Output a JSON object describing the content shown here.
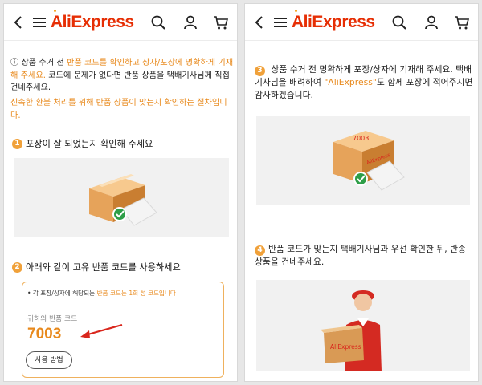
{
  "header": {
    "back_icon": "chevron-left-icon",
    "menu_icon": "hamburger-menu-icon",
    "logo_prefix": "Ali",
    "logo_suffix": "Express",
    "search_icon": "search-icon",
    "account_icon": "user-icon",
    "cart_icon": "cart-icon",
    "brand_color": "#e62e04"
  },
  "left": {
    "intro": {
      "info_icon": "ⓘ",
      "part1": "상품 수거 전 ",
      "part2_orange": "반품 코드를 확인하고 상자/포장에 명확하게 기재해 주세요.",
      "part3": " 코드에 문제가 없다면 반품 상품을 택배기사님께 직접 건네주세요.",
      "note_orange": "신속한 환불 처리를 위해 반품 상품이 맞는지 확인하는 절차입니다."
    },
    "step1": {
      "number": "1",
      "text": "포장이 잘 되었는지 확인해 주세요"
    },
    "step2": {
      "number": "2",
      "text": "아래와 같이 고유 반품 코드를 사용하세요"
    },
    "code_card": {
      "note_prefix": "• 각 포장/상자에 해당되는 ",
      "note_highlight": "반품 코드는 1회 성 코드입니다",
      "label": "귀하의 반품 코드",
      "code": "7003",
      "button": "사용 방법"
    }
  },
  "right": {
    "step3": {
      "number": "3",
      "part1": " 상품 수거 전 명확하게 포장/상자에 기재해 주세요. 택배기사님을 배려하여 ",
      "highlight": "\"AliExpress\"",
      "part2": "도 함께 포장에 적어주시면 감사하겠습니다."
    },
    "box_writing": "7003",
    "box_brand": "AliExpress",
    "step4": {
      "number": "4",
      "text": "반품 코드가 맞는지 택배기사님과 우선 확인한 뒤, 반송 상품을 건네주세요."
    },
    "courier_box_brand": "AliExpress"
  },
  "colors": {
    "accent": "#e8891c",
    "badge": "#f0a13a",
    "check": "#2e9e48"
  }
}
